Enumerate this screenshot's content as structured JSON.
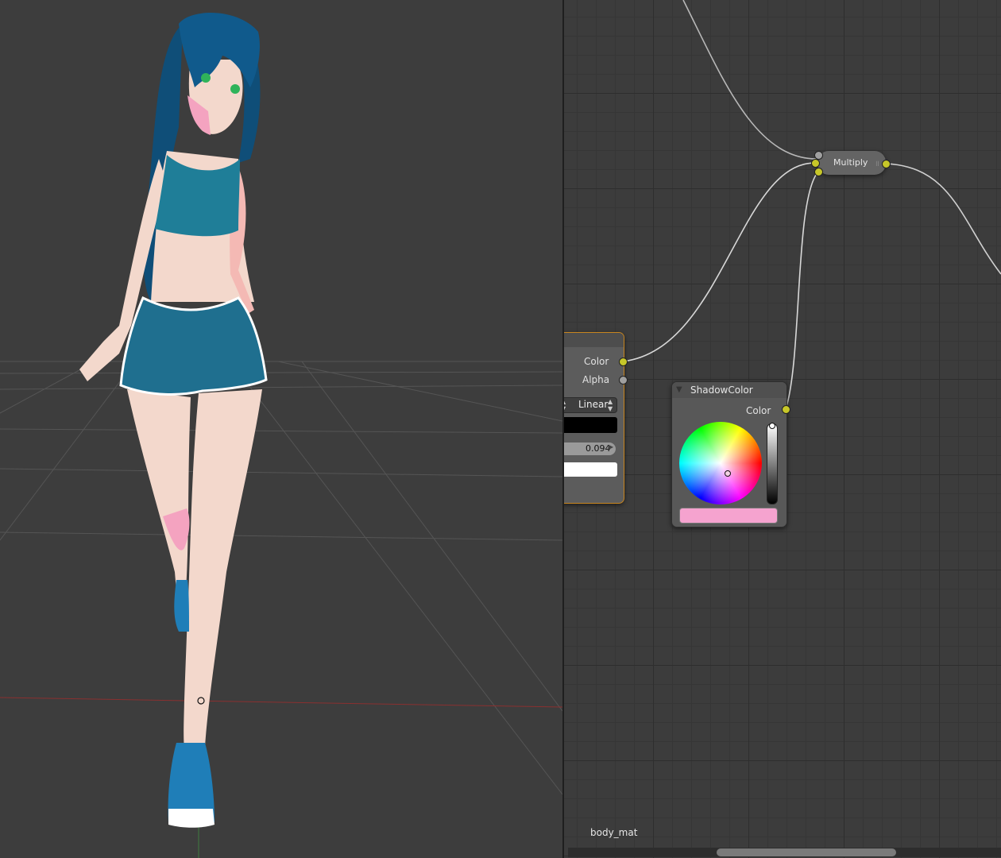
{
  "viewport": {
    "background": "#3d3d3d",
    "character": {
      "hair_color": "#0f4e78",
      "skin_color": "#f3d8cc",
      "shadow_color": "#f4a3c0",
      "outfit_color": "#1f7e98",
      "eye_color": "#2fb35a"
    }
  },
  "node_editor": {
    "texture_node": {
      "color_socket_label": "Color",
      "alpha_socket_label": "Alpha",
      "interpolation": "Linear",
      "value": "0.094"
    },
    "multiply_node": {
      "label": "Multiply"
    },
    "shadow_color_node": {
      "title": "ShadowColor",
      "color_socket_label": "Color",
      "color": "#f5a3cf"
    },
    "material_name": "body_mat"
  },
  "colors": {
    "accent_socket": "#c7c729",
    "selected_outline": "#c7851f"
  }
}
